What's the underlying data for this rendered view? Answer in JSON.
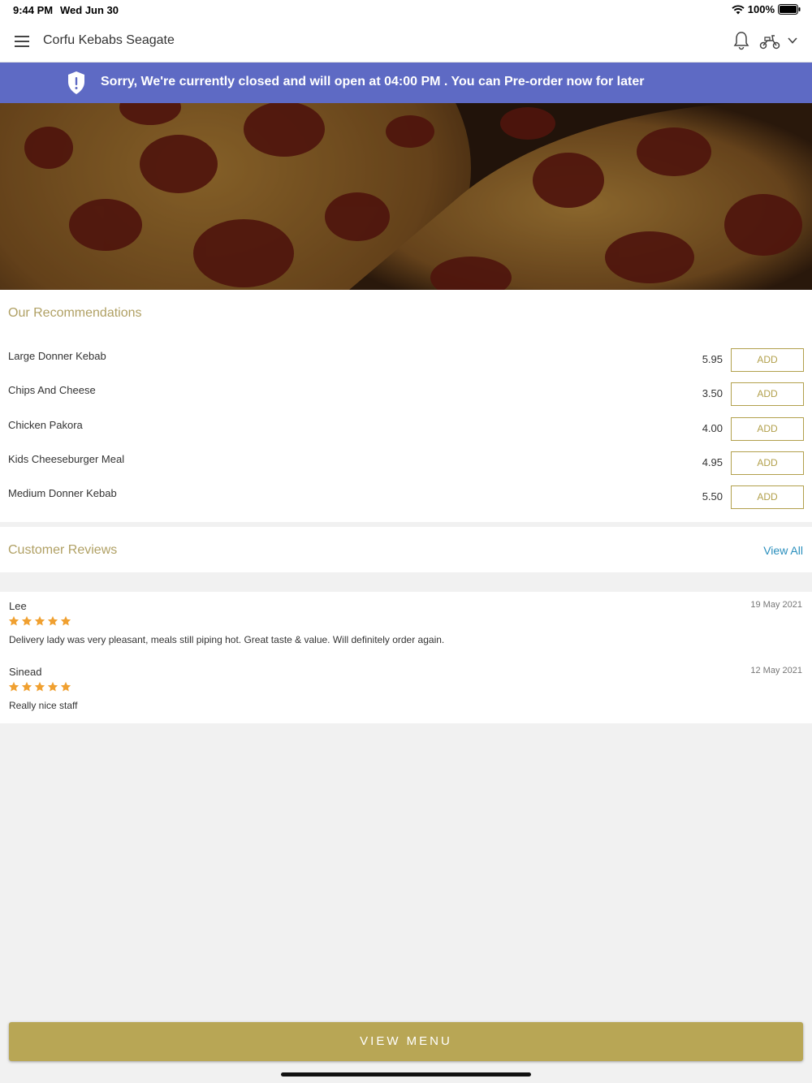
{
  "status": {
    "time": "9:44 PM",
    "date": "Wed Jun 30",
    "battery": "100%"
  },
  "header": {
    "title": "Corfu Kebabs Seagate"
  },
  "banner": {
    "message": "Sorry, We're currently closed and will open at 04:00 PM . You can Pre-order now for later",
    "color": "#5e6ac4"
  },
  "recommendations": {
    "title": "Our Recommendations",
    "items": [
      {
        "name": "Large Donner Kebab",
        "price": "5.95",
        "button": "ADD"
      },
      {
        "name": "Chips And Cheese",
        "price": "3.50",
        "button": "ADD"
      },
      {
        "name": "Chicken Pakora",
        "price": "4.00",
        "button": "ADD"
      },
      {
        "name": "Kids Cheeseburger Meal",
        "price": "4.95",
        "button": "ADD"
      },
      {
        "name": "Medium Donner Kebab",
        "price": "5.50",
        "button": "ADD"
      }
    ]
  },
  "reviews": {
    "title": "Customer Reviews",
    "view_all": "View All",
    "items": [
      {
        "name": "Lee",
        "date": "19 May 2021",
        "rating": 5,
        "text": "Delivery lady was very pleasant, meals still piping hot. Great taste & value. Will definitely order again."
      },
      {
        "name": "Sinead",
        "date": "12 May 2021",
        "rating": 5,
        "text": "Really nice staff"
      }
    ]
  },
  "footer": {
    "view_menu": "VIEW MENU"
  },
  "colors": {
    "accent": "#b8a655",
    "link": "#2a8fbd",
    "star": "#f0a030"
  },
  "icons": [
    "wifi-icon",
    "battery-icon",
    "hamburger-menu-icon",
    "bell-icon",
    "scooter-icon",
    "chevron-down-icon",
    "shield-alert-icon",
    "star-icon"
  ]
}
